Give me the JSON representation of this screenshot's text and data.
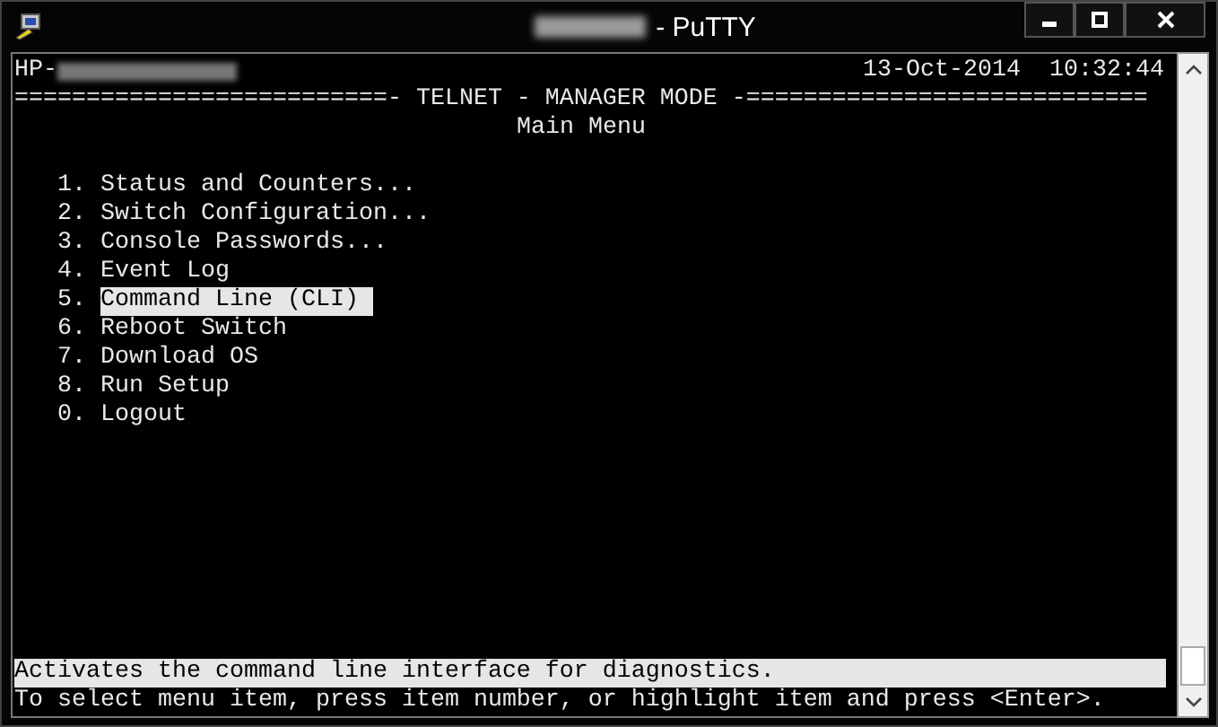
{
  "window": {
    "title": "- PuTTY"
  },
  "terminal": {
    "header_left": "HP-",
    "header_right": "13-Oct-2014  10:32:44",
    "banner": "==========================- TELNET - MANAGER MODE -============================",
    "menu_title": "Main Menu",
    "items": [
      {
        "number": "1.",
        "label": "Status and Counters...",
        "selected": false
      },
      {
        "number": "2.",
        "label": "Switch Configuration...",
        "selected": false
      },
      {
        "number": "3.",
        "label": "Console Passwords...",
        "selected": false
      },
      {
        "number": "4.",
        "label": "Event Log",
        "selected": false
      },
      {
        "number": "5.",
        "label": "Command Line (CLI)",
        "selected": true
      },
      {
        "number": "6.",
        "label": "Reboot Switch",
        "selected": false
      },
      {
        "number": "7.",
        "label": "Download OS",
        "selected": false
      },
      {
        "number": "8.",
        "label": "Run Setup",
        "selected": false
      },
      {
        "number": "0.",
        "label": "Logout",
        "selected": false
      }
    ],
    "help_line": "Activates the command line interface for diagnostics.",
    "hint_line": "To select menu item, press item number, or highlight item and press <Enter>."
  }
}
